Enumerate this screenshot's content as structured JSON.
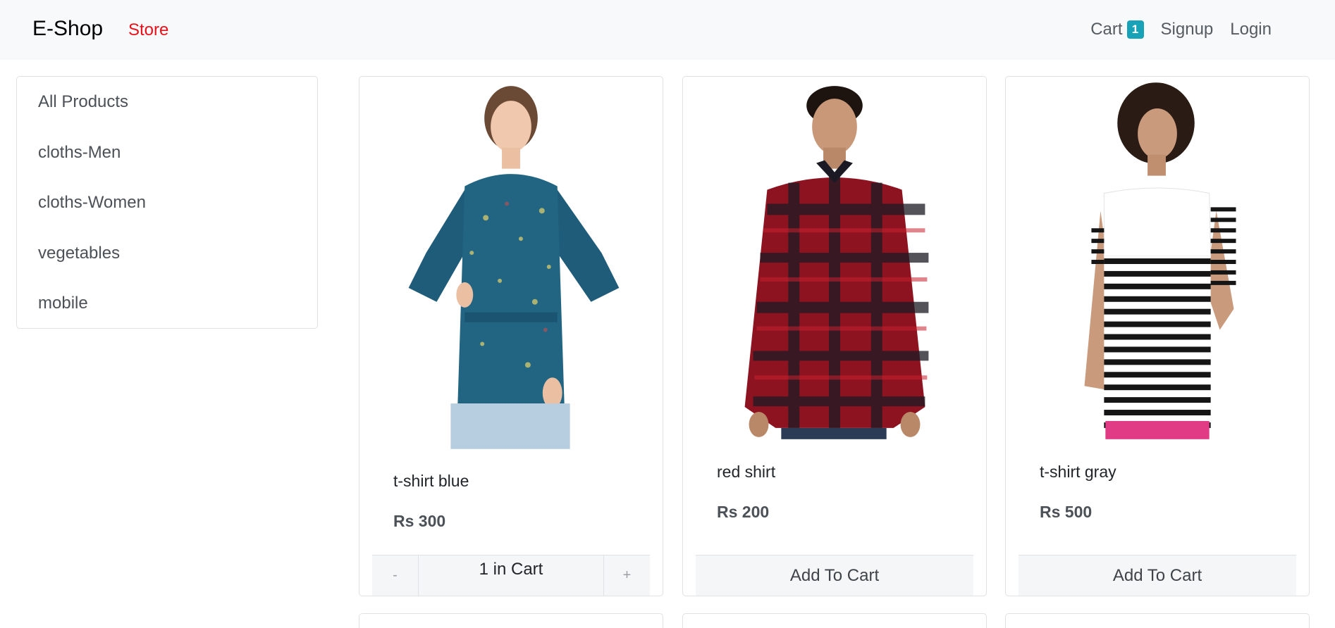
{
  "navbar": {
    "brand": "E-Shop",
    "store_link": "Store",
    "cart_label": "Cart",
    "cart_count": "1",
    "signup_label": "Signup",
    "login_label": "Login"
  },
  "sidebar": {
    "items": [
      {
        "label": "All Products"
      },
      {
        "label": "cloths-Men"
      },
      {
        "label": "cloths-Women"
      },
      {
        "label": "vegetables"
      },
      {
        "label": "mobile"
      }
    ]
  },
  "products": [
    {
      "title": "t-shirt blue",
      "price": "Rs 300",
      "in_cart": true,
      "qty_label": "1 in Cart",
      "minus": "-",
      "plus": "+"
    },
    {
      "title": "red shirt",
      "price": "Rs 200",
      "in_cart": false,
      "button_label": "Add To Cart"
    },
    {
      "title": "t-shirt gray",
      "price": "Rs 500",
      "in_cart": false,
      "button_label": "Add To Cart"
    }
  ],
  "colors": {
    "brand_red": "#e8101a",
    "badge": "#17a2b8",
    "navbar_bg": "#f8f9fa"
  }
}
